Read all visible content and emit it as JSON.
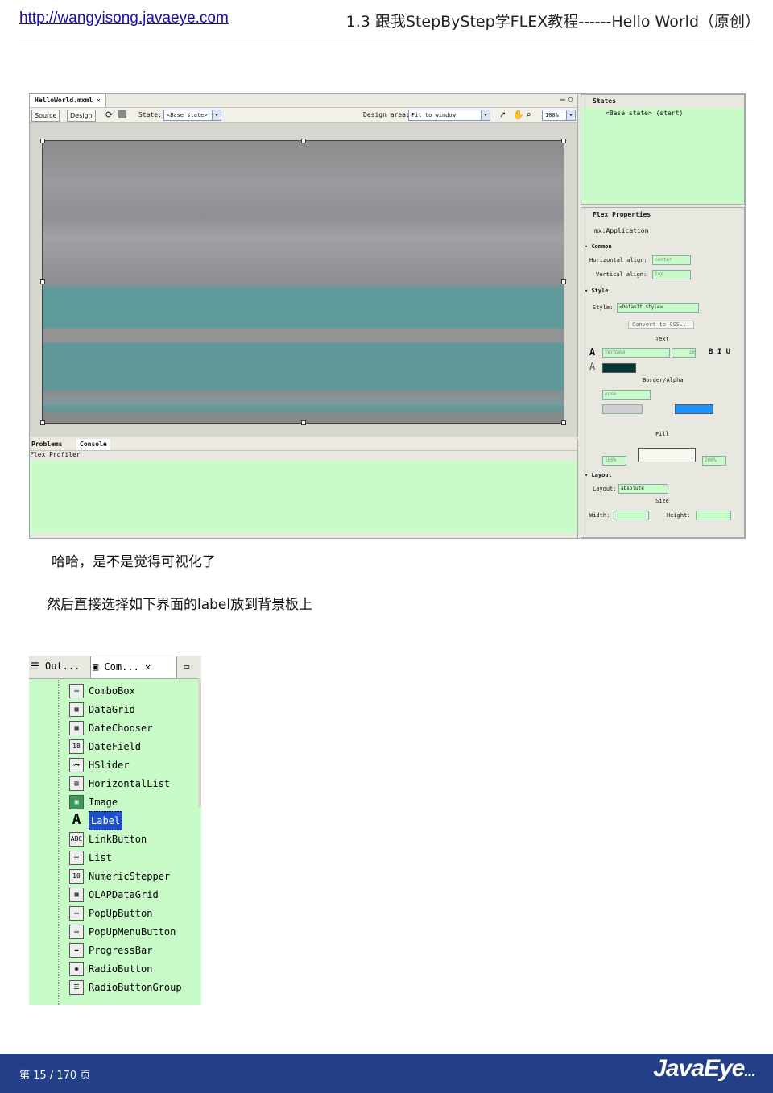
{
  "header": {
    "link": "http://wangyisong.javaeye.com",
    "title": "1.3 跟我StepByStep学FLEX教程------Hello World（原创）"
  },
  "ide": {
    "editor_tab": "HelloWorld.mxml",
    "source_btn": "Source",
    "design_btn": "Design",
    "state_label": "State:",
    "state_value": "<Base state>",
    "design_area_label": "Design area:",
    "design_area_value": "Fit to window",
    "zoom_value": "100%",
    "console_tabs": [
      "Problems",
      "Console"
    ],
    "console_title": "Flex Profiler",
    "states_tab": "States",
    "states_item": "<Base state> (start)",
    "props_tab": "Flex Properties",
    "props_component": "mx:Application",
    "common_section": "Common",
    "halign_label": "Horizontal align:",
    "halign_value": "center",
    "valign_label": "Vertical align:",
    "valign_value": "top",
    "style_section": "Style",
    "style_label": "Style:",
    "style_value": "<Default style>",
    "convert_css": "Convert to CSS...",
    "text_label": "Text",
    "font_value": "Verdana",
    "font_size": "10",
    "bold_italic_underline": "B I U",
    "border_alpha_label": "Border/Alpha",
    "border_value": "none",
    "fill_label": "Fill",
    "alpha1": "100%",
    "alpha2": "100%",
    "layout_section": "Layout",
    "layout_label": "Layout:",
    "layout_value": "absolute",
    "size_label": "Size",
    "width_label": "Width:",
    "height_label": "Height:"
  },
  "body": {
    "line1": "哈哈，是不是觉得可视化了",
    "line2": "然后直接选择如下界面的label放到背景板上"
  },
  "palette": {
    "tab_outline": "Out...",
    "tab_components": "Com...",
    "items": [
      {
        "label": "ComboBox",
        "icon": "combobox-icon"
      },
      {
        "label": "DataGrid",
        "icon": "datagrid-icon"
      },
      {
        "label": "DateChooser",
        "icon": "datechooser-icon"
      },
      {
        "label": "DateField",
        "icon": "datefield-icon"
      },
      {
        "label": "HSlider",
        "icon": "hslider-icon"
      },
      {
        "label": "HorizontalList",
        "icon": "horizontallist-icon"
      },
      {
        "label": "Image",
        "icon": "image-icon"
      },
      {
        "label": "Label",
        "icon": "label-icon",
        "selected": true
      },
      {
        "label": "LinkButton",
        "icon": "linkbutton-icon"
      },
      {
        "label": "List",
        "icon": "list-icon"
      },
      {
        "label": "NumericStepper",
        "icon": "numericstepper-icon"
      },
      {
        "label": "OLAPDataGrid",
        "icon": "olapdatagrid-icon"
      },
      {
        "label": "PopUpButton",
        "icon": "popupbutton-icon"
      },
      {
        "label": "PopUpMenuButton",
        "icon": "popupmenubutton-icon"
      },
      {
        "label": "ProgressBar",
        "icon": "progressbar-icon"
      },
      {
        "label": "RadioButton",
        "icon": "radiobutton-icon"
      },
      {
        "label": "RadioButtonGroup",
        "icon": "radiobuttongroup-icon"
      }
    ]
  },
  "footer": {
    "page": "第 15 / 170 页",
    "logo": "JavaEye",
    "logo_dots": "..."
  },
  "colors": {
    "footer_bg": "#223f87",
    "panel_green": "#c9fbc8",
    "selection": "#1c4fc9"
  }
}
